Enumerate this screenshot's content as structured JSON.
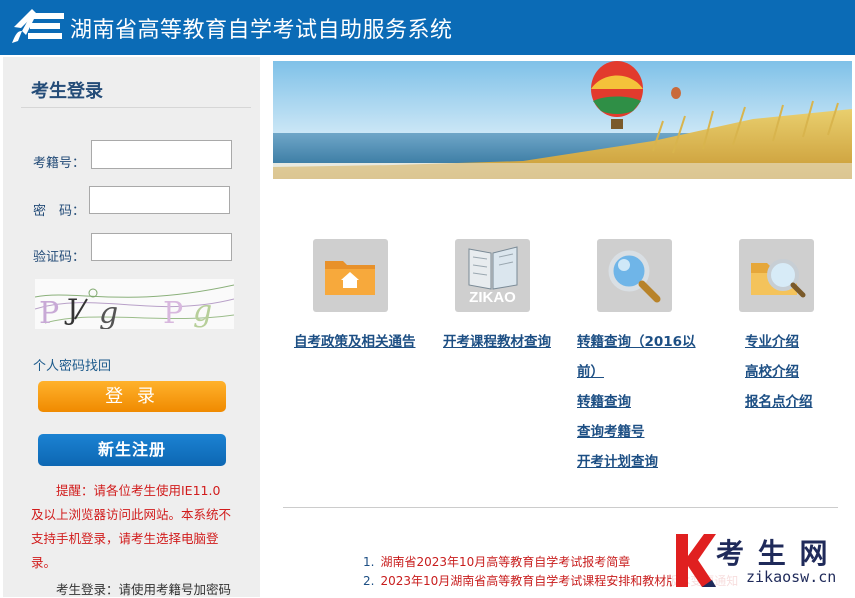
{
  "header": {
    "title": "湖南省高等教育自学考试自助服务系统"
  },
  "login": {
    "title": "考生登录",
    "id_label": "考籍号：",
    "pwd_label": "密　码：",
    "captcha_label": "验证码：",
    "captcha_text": "PJgPg",
    "forgot_link": "个人密码找回",
    "login_button": "登 录",
    "register_button": "新生注册",
    "notice": "提醒：请各位考生使用IE11.0及以上浏览器访问此网站。本系统不支持手机登录，请考生选择电脑登录。",
    "notice2": "考生登录：请使用考籍号加密码"
  },
  "tiles": [
    {
      "label": "自考政策及相关通告",
      "icon": "folder-home-icon"
    },
    {
      "label": "开考课程教材查询",
      "icon": "zikao-book-icon",
      "icon_text": "ZIKAO"
    },
    {
      "label": "转籍查询（2016以前）",
      "icon": "magnifier-icon"
    },
    {
      "label": "专业介绍",
      "icon": "folder-search-icon"
    }
  ],
  "links": {
    "col3": [
      "转籍查询（2016以",
      "前）",
      "转籍查询",
      "查询考籍号",
      "开考计划查询"
    ],
    "col4": [
      "专业介绍",
      "高校介绍",
      "报名点介绍"
    ]
  },
  "news": [
    {
      "num": "1.",
      "text": "湖南省2023年10月高等教育自学考试报考简章"
    },
    {
      "num": "2.",
      "text": "2023年10月湖南省高等教育自学考试课程安排和教材版本变更通知"
    }
  ],
  "watermark": {
    "main": "考 生 网",
    "sub": "zikaosw.cn",
    "letter": "K"
  },
  "colors": {
    "header": "#0b6bb6",
    "login_button": "#f5961a",
    "register_button": "#1176c6",
    "link": "#1d4f84",
    "notice": "#d11c1c"
  }
}
